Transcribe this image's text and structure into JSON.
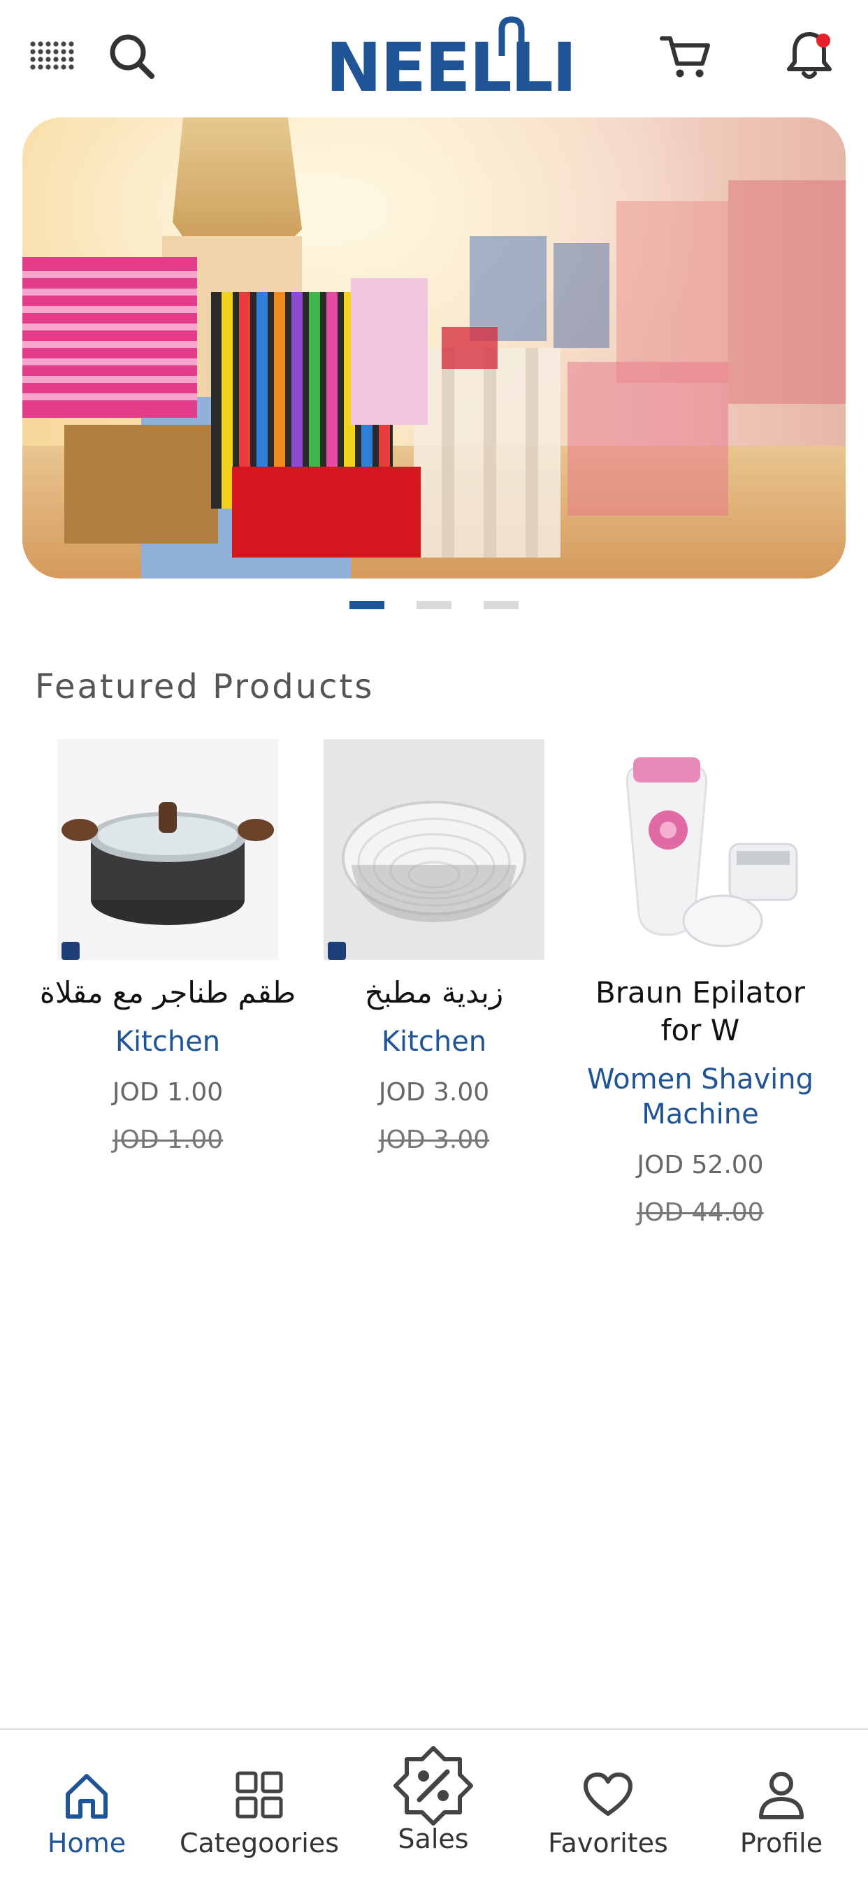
{
  "header": {
    "logo_text": "NEELLI",
    "icons": [
      "menu-icon",
      "search-icon",
      "cart-icon",
      "bell-icon"
    ],
    "has_notification": true
  },
  "banner": {
    "slides": 3,
    "active_slide": 1
  },
  "featured": {
    "title": "Featured Products",
    "products": [
      {
        "name": "طقم طناجر مع مقلاة",
        "category": "Kitchen",
        "price": "JOD 1.00",
        "old_price": "JOD 1.00"
      },
      {
        "name": "زبدية مطبخ",
        "category": "Kitchen",
        "price": "JOD 3.00",
        "old_price": "JOD 3.00"
      },
      {
        "name": "Braun Epilator for W",
        "category": "Women Shaving Machine",
        "price": "JOD 52.00",
        "old_price": "JOD 44.00"
      }
    ]
  },
  "nav": {
    "home": "Home",
    "categories": "Categoories",
    "sales": "Sales",
    "favorites": "Favorites",
    "profile": "Profile",
    "active": "home"
  },
  "colors": {
    "brand": "#1f5496",
    "notification": "#e8202a",
    "inactive_dot": "#d9d9d9"
  }
}
